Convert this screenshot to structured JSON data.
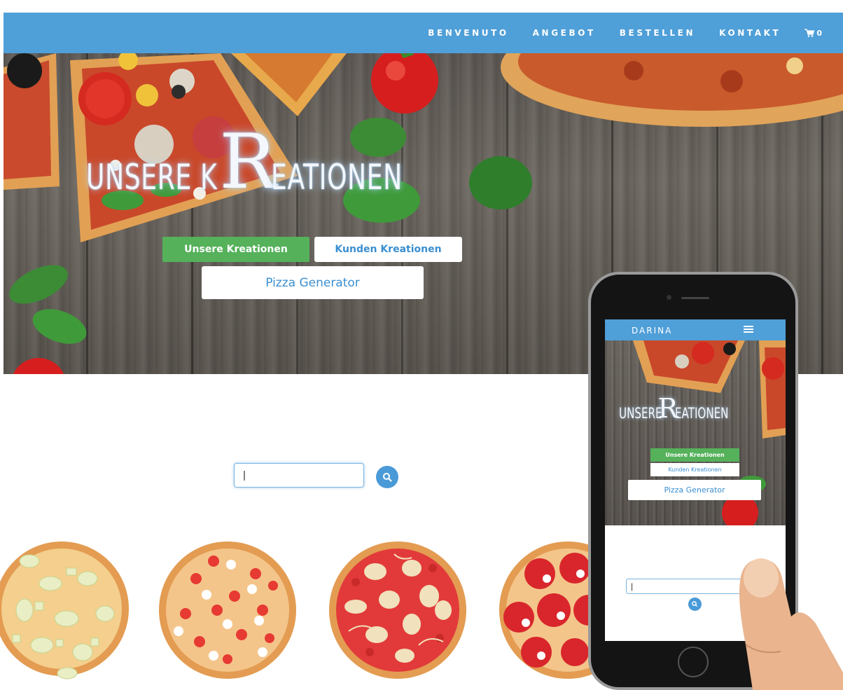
{
  "nav": {
    "links": [
      "BENVENUTO",
      "ANGEBOT",
      "BESTELLEN",
      "KONTAKT"
    ],
    "cart_count": "0",
    "color": "#4f9fd8"
  },
  "hero": {
    "title_left": "UNSERE K",
    "title_big": "R",
    "title_right": "EATIONEN",
    "btn_unsere": "Unsere Kreationen",
    "btn_kunden": "Kunden Kreationen",
    "btn_generator": "Pizza Generator"
  },
  "search": {
    "value": "|",
    "button_icon": "search-icon"
  },
  "pizzas": [
    {
      "name": "pizza-artichoke"
    },
    {
      "name": "pizza-tomato-mozzarella"
    },
    {
      "name": "pizza-margherita-mushroom"
    },
    {
      "name": "pizza-salami"
    }
  ],
  "mobile": {
    "logo": "DARINA",
    "title_left": "UNSERE ",
    "title_big": "R",
    "title_right": "EATIONEN",
    "btn_unsere": "Unsere Kreationen",
    "btn_kunden": "Kunden Kreationen",
    "btn_generator": "Pizza Generator",
    "search_value": "|"
  },
  "colors": {
    "accent": "#4f9fd8",
    "green": "#55b15a",
    "button_text": "#3b8fd0"
  }
}
